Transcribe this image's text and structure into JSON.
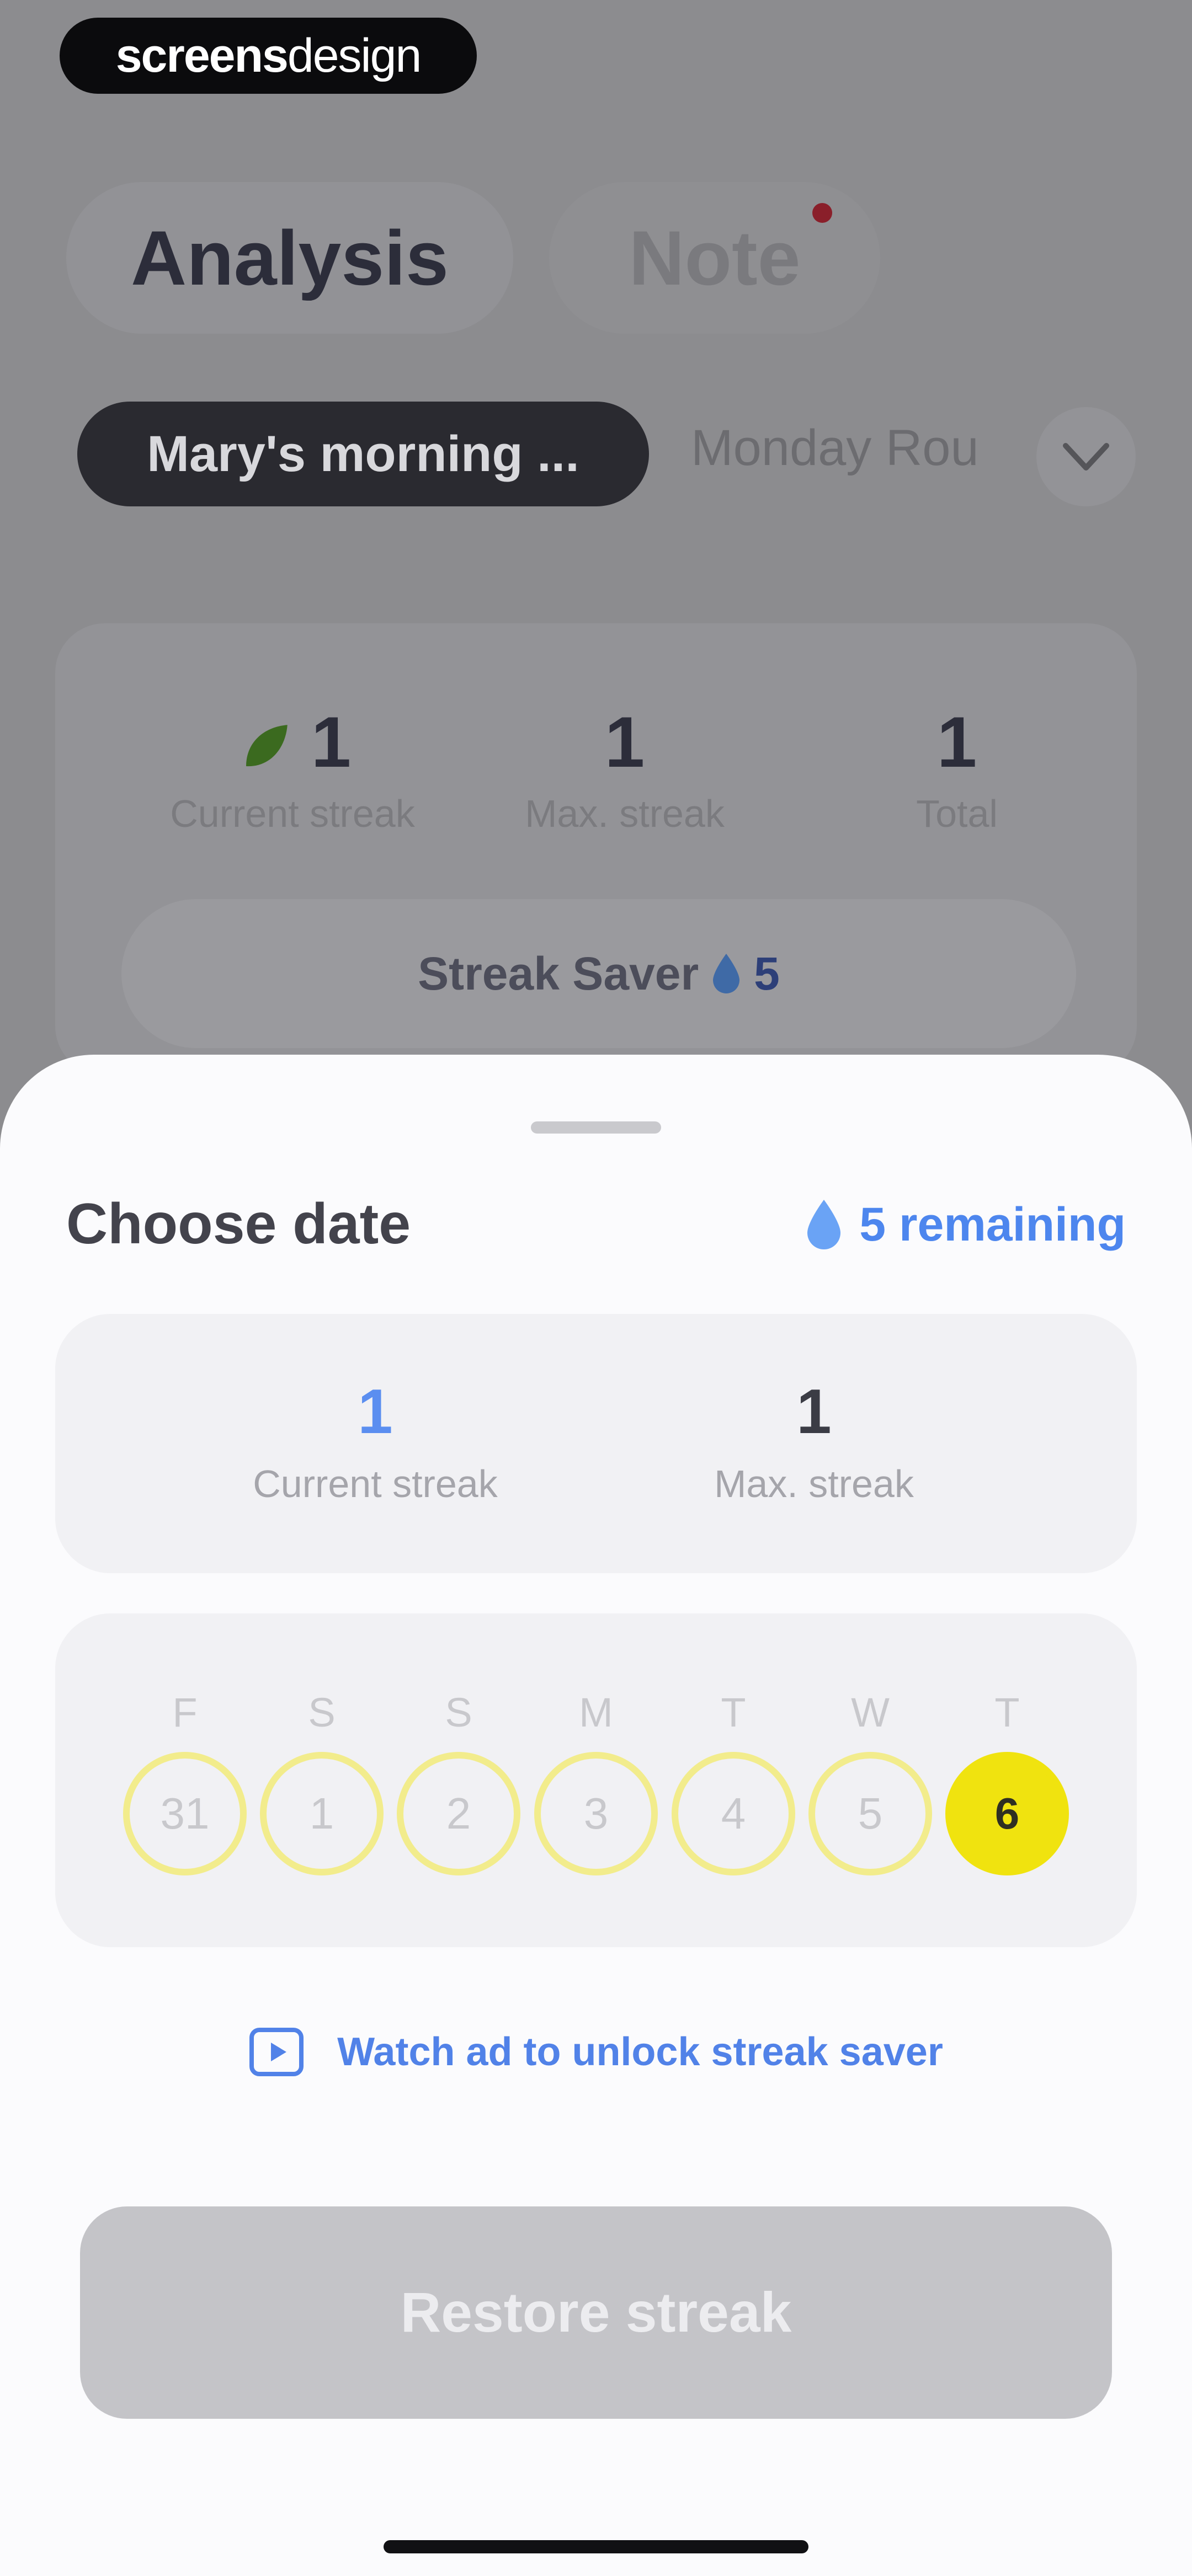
{
  "logo": {
    "bold": "screens",
    "light": "design"
  },
  "tabs": [
    {
      "label": "Analysis",
      "active": true
    },
    {
      "label": "Note",
      "has_notification_dot": true
    }
  ],
  "routines": {
    "selected": "Mary's morning ...",
    "next": "Monday Rou"
  },
  "background_stats": [
    {
      "value": "1",
      "label": "Current streak"
    },
    {
      "value": "1",
      "label": "Max. streak"
    },
    {
      "value": "1",
      "label": "Total"
    }
  ],
  "streak_saver": {
    "label": "Streak Saver",
    "count": "5"
  },
  "sheet": {
    "title": "Choose date",
    "remaining": "5 remaining",
    "current_streak": {
      "value": "1",
      "label": "Current streak"
    },
    "max_streak": {
      "value": "1",
      "label": "Max. streak"
    },
    "days": [
      {
        "dow": "F",
        "date": "31",
        "active": false
      },
      {
        "dow": "S",
        "date": "1",
        "active": false
      },
      {
        "dow": "S",
        "date": "2",
        "active": false
      },
      {
        "dow": "M",
        "date": "3",
        "active": false
      },
      {
        "dow": "T",
        "date": "4",
        "active": false
      },
      {
        "dow": "W",
        "date": "5",
        "active": false
      },
      {
        "dow": "T",
        "date": "6",
        "active": true
      }
    ],
    "watch_ad": "Watch ad to unlock streak saver",
    "restore_button": "Restore streak"
  },
  "colors": {
    "accent_blue": "#4d86ee",
    "highlight_yellow": "#f0e30f",
    "ring_yellow": "#f2ec8c"
  }
}
